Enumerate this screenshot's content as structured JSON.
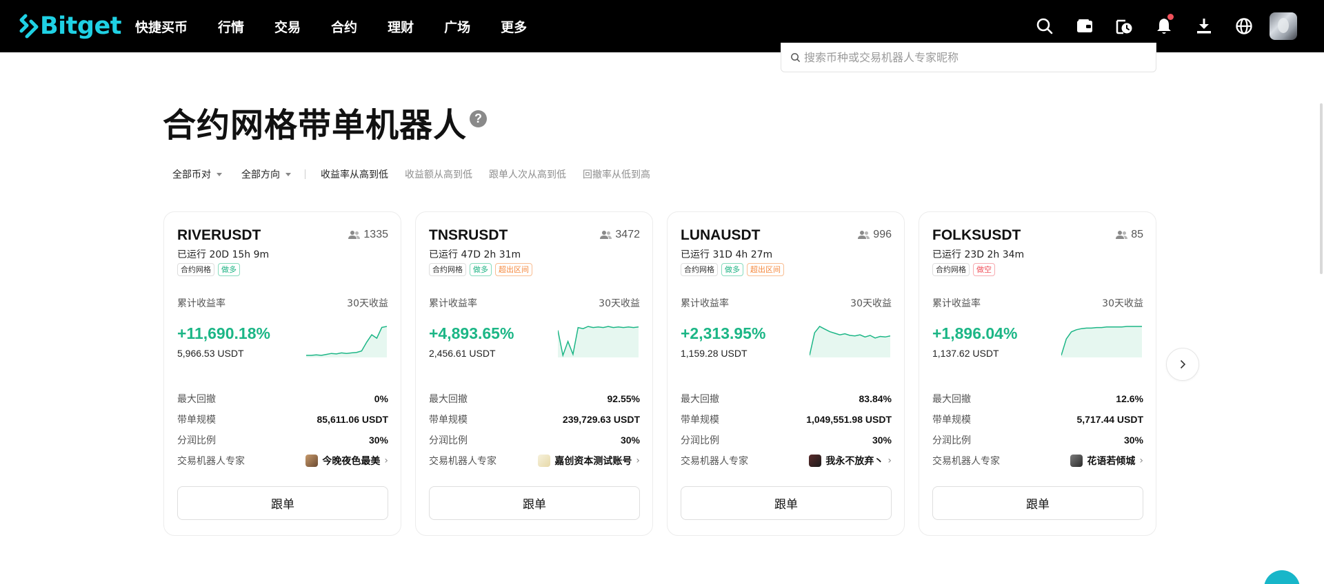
{
  "brand": {
    "name": "Bitget",
    "accent": "#1fd1e4"
  },
  "nav": {
    "items": [
      "快捷买币",
      "行情",
      "交易",
      "合约",
      "理财",
      "广场",
      "更多"
    ],
    "icons": [
      "search-icon",
      "wallet-icon",
      "history-icon",
      "bell-icon",
      "download-icon",
      "globe-icon"
    ]
  },
  "search": {
    "placeholder": "搜索币种或交易机器人专家昵称"
  },
  "page": {
    "title": "合约网格带单机器人",
    "help": "?"
  },
  "filters": {
    "pair": "全部币对",
    "direction": "全部方向",
    "sorts": [
      "收益率从高到低",
      "收益额从高到低",
      "跟单人次从高到低",
      "回撤率从低到高"
    ],
    "active_sort": 0
  },
  "labels": {
    "cumulative_rate": "累计收益率",
    "thirty_day": "30天收益",
    "max_drawdown": "最大回撤",
    "scale": "带单规模",
    "share": "分润比例",
    "expert": "交易机器人专家",
    "follow": "跟单"
  },
  "colors": {
    "profit": "#1cb686",
    "long": "#1db383",
    "short": "#f0515b",
    "out_of_range": "#f5883d"
  },
  "cards": [
    {
      "symbol": "RIVERUSDT",
      "followers": "1335",
      "runtime": "已运行 20D 15h 9m",
      "tags": [
        {
          "text": "合约网格",
          "kind": "plain"
        },
        {
          "text": "做多",
          "kind": "long"
        }
      ],
      "rate": "+11,690.18%",
      "amount": "5,966.53 USDT",
      "drawdown": "0%",
      "scale": "85,611.06 USDT",
      "share": "30%",
      "expert": "今晚夜色最美",
      "spark": [
        3,
        3,
        4,
        3,
        5,
        7,
        6,
        8,
        7,
        8,
        9,
        12,
        30,
        45,
        38,
        60,
        62
      ]
    },
    {
      "symbol": "TNSRUSDT",
      "followers": "3472",
      "runtime": "已运行 47D 2h 31m",
      "tags": [
        {
          "text": "合约网格",
          "kind": "plain"
        },
        {
          "text": "做多",
          "kind": "long"
        },
        {
          "text": "超出区间",
          "kind": "out"
        }
      ],
      "rate": "+4,893.65%",
      "amount": "2,456.61 USDT",
      "drawdown": "92.55%",
      "scale": "239,729.63 USDT",
      "share": "30%",
      "expert": "嘉创资本测试账号",
      "spark": [
        55,
        10,
        35,
        12,
        60,
        58,
        62,
        60,
        61,
        60,
        62,
        60,
        61,
        60,
        61,
        60,
        61
      ]
    },
    {
      "symbol": "LUNAUSDT",
      "followers": "996",
      "runtime": "已运行 31D 4h 27m",
      "tags": [
        {
          "text": "合约网格",
          "kind": "plain"
        },
        {
          "text": "做多",
          "kind": "long"
        },
        {
          "text": "超出区间",
          "kind": "out"
        }
      ],
      "rate": "+2,313.95%",
      "amount": "1,159.28 USDT",
      "drawdown": "83.84%",
      "scale": "1,049,551.98 USDT",
      "share": "30%",
      "expert": "我永不放弃丶",
      "spark": [
        5,
        48,
        60,
        55,
        50,
        47,
        44,
        46,
        43,
        42,
        44,
        40,
        43,
        38,
        41,
        40,
        42
      ]
    },
    {
      "symbol": "FOLKSUSDT",
      "followers": "85",
      "runtime": "已运行 23D 2h 34m",
      "tags": [
        {
          "text": "合约网格",
          "kind": "plain"
        },
        {
          "text": "做空",
          "kind": "short"
        }
      ],
      "rate": "+1,896.04%",
      "amount": "1,137.62 USDT",
      "drawdown": "12.6%",
      "scale": "5,717.44 USDT",
      "share": "30%",
      "expert": "花语若倾城",
      "spark": [
        5,
        35,
        48,
        52,
        54,
        55,
        55,
        56,
        56,
        57,
        57,
        57,
        57,
        58,
        58,
        58,
        58
      ]
    }
  ]
}
